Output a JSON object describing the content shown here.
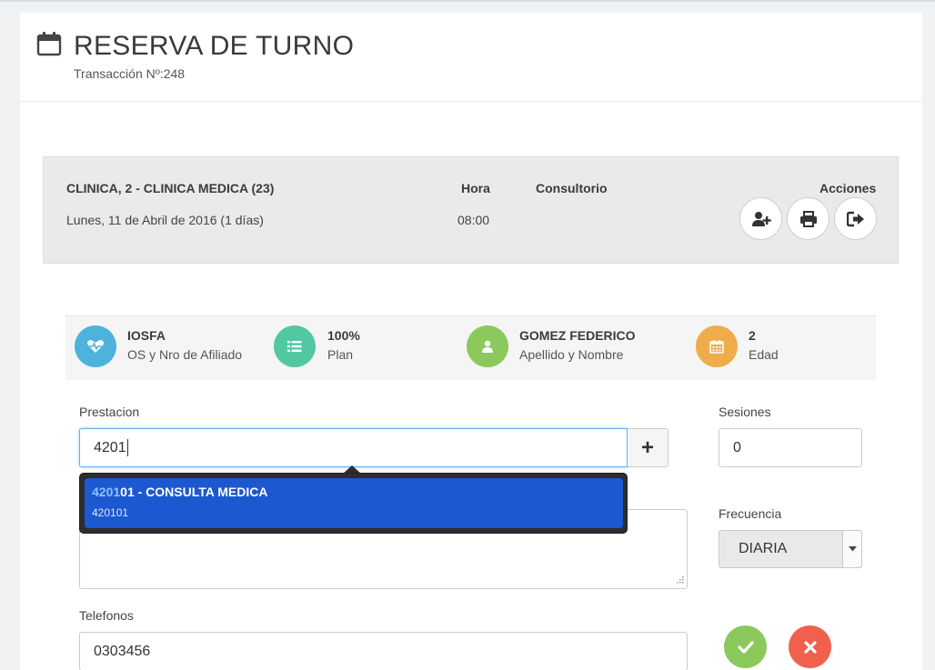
{
  "header": {
    "title": "RESERVA DE TURNO",
    "transaction": "Transacción Nº:248"
  },
  "appointment": {
    "service": "CLINICA, 2 - CLINICA MEDICA (23)",
    "date": "Lunes, 11 de Abril de 2016 (1 días)",
    "hora_label": "Hora",
    "hora_value": "08:00",
    "consultorio_label": "Consultorio",
    "acciones_label": "Acciones",
    "action_icons": [
      "add-user-icon",
      "print-icon",
      "sign-out-icon"
    ]
  },
  "patient": {
    "obra_social": {
      "value": "IOSFA",
      "label": "OS y Nro de Afiliado",
      "color": "#4db3dd",
      "icon": "heartbeat-icon"
    },
    "plan": {
      "value": "100%",
      "label": "Plan",
      "color": "#52c8a2",
      "icon": "list-icon"
    },
    "name": {
      "value": "GOMEZ FEDERICO",
      "label": "Apellido y Nombre",
      "color": "#8cc95d",
      "icon": "user-icon"
    },
    "age": {
      "value": "2",
      "label": "Edad",
      "color": "#eeac4b",
      "icon": "calendar-icon"
    }
  },
  "form": {
    "prestacion_label": "Prestacion",
    "prestacion_value": "4201",
    "add_symbol": "+",
    "autocomplete": {
      "match": "4201",
      "rest": "01 - CONSULTA MEDICA",
      "code": "420101"
    },
    "sesiones_label": "Sesiones",
    "sesiones_value": "0",
    "frecuencia_label": "Frecuencia",
    "frecuencia_value": "DIARIA",
    "telefonos_label": "Telefonos",
    "telefonos_value": "0303456",
    "confirm_color": "#8cc95d",
    "cancel_color": "#f0614d"
  }
}
